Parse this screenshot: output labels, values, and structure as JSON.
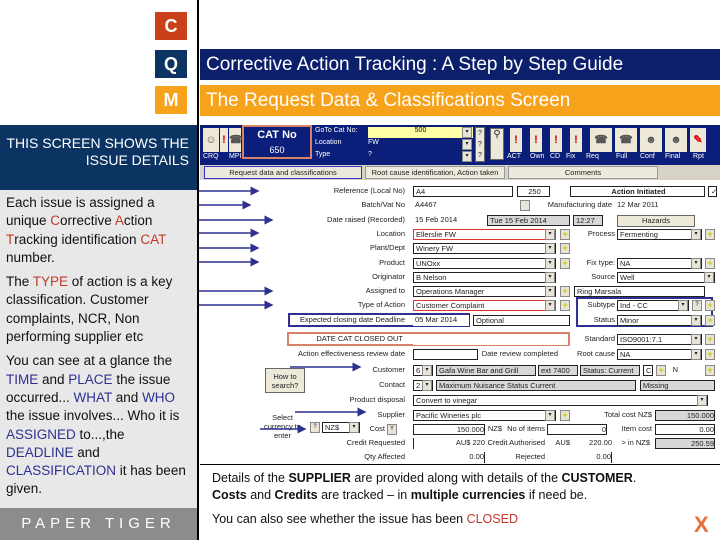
{
  "logo": {
    "c": "C",
    "q": "Q",
    "m": "M"
  },
  "colors": {
    "navy": "#0b1f6b",
    "orange": "#f7a21b",
    "red_logo": "#c8411b",
    "teal_logo": "#0b3463"
  },
  "title": "Corrective Action Tracking : A Step by Step Guide",
  "subtitle": "The Request Data & Classifications Screen",
  "left": {
    "heading": "THIS SCREEN SHOWS THE ISSUE DETAILS",
    "p1": [
      "Each issue is assigned a unique ",
      "C",
      "orrective ",
      "A",
      "ction ",
      "T",
      "racking identification ",
      "CAT",
      " number."
    ],
    "p2": [
      "The ",
      "TYPE",
      " of action is a key classification. Customer complaints, NCR, Non performing supplier etc"
    ],
    "p3": [
      "You can see at a glance the ",
      "TIME",
      " and ",
      "PLACE",
      " the issue occurred... ",
      "WHAT",
      " and ",
      "WHO",
      " the issue involves... Who it is ",
      "ASSIGNED",
      " to...,the ",
      "DEADLINE",
      " and ",
      "CLASSIFICATION",
      " it has been given."
    ],
    "footer": "PAPER TIGER"
  },
  "app": {
    "toolbar": {
      "buttons": [
        "CRQ",
        "MPI",
        "ACT",
        "Own",
        "CD",
        "Fix",
        "Req",
        "Full",
        "Conf",
        "Final",
        "Rpt"
      ],
      "cat_label": "CAT No",
      "cat_value": "650",
      "goto_label": "GoTo Cat No:",
      "goto_value": "500",
      "location_label": "Location",
      "location_value": "FW",
      "type_label": "Type",
      "type_value": "?"
    },
    "tabs": [
      "Request data and classifications",
      "Root cause identification, Action taken",
      "Comments"
    ],
    "rows": {
      "reference": {
        "label": "Reference (Local No)",
        "value": "A4",
        "value2": "250",
        "status": "Action Initiated"
      },
      "batch": {
        "label": "Batch/Vat No",
        "value": "A4467",
        "mfg_label": "Manufacturing date",
        "mfg_value": "12 Mar 2011"
      },
      "date_raised": {
        "label": "Date raised (Recorded)",
        "value": "15 Feb 2014",
        "day": "Tue 15 Feb 2014",
        "time": "12:27",
        "hazards": "Hazards"
      },
      "location": {
        "label": "Location",
        "value": "Ellerslie FW",
        "r_label": "Process",
        "r_value": "Fermenting"
      },
      "plant": {
        "label": "Plant/Dept",
        "value": "Winery FW"
      },
      "product": {
        "label": "Product",
        "value": "UNOxx",
        "r_label": "Fix type:",
        "r_value": "NA"
      },
      "originator": {
        "label": "Originator",
        "value": "B Nelson",
        "r_label": "Source",
        "r_value": "Well"
      },
      "assigned": {
        "label": "Assigned to",
        "value": "Operations Manager",
        "r_value": "Ring Marsala"
      },
      "type": {
        "label": "Type of Action",
        "value": "Customer Complaint",
        "r_label": "Subtype",
        "r_value": "Ind - CC"
      },
      "expected": {
        "label": "Expected closing date Deadline",
        "value": "05 Mar 2014",
        "opt": "Optional",
        "r_label": "Status",
        "r_value": "Minor"
      },
      "closed": {
        "label": "DATE CAT CLOSED OUT",
        "value": "",
        "r_label": "Standard",
        "r_value": "ISO9001:7.1"
      },
      "review": {
        "label": "Action effectiveness review date",
        "mid_label": "Date review completed",
        "r_label": "Root cause",
        "r_value": "NA"
      },
      "customer": {
        "label": "Customer",
        "code": "6",
        "value": "Gafa Wine Bar and Grill",
        "ext": "ext 7400",
        "status": "Status: Current",
        "c": "C",
        "n": "N"
      },
      "contact": {
        "label": "Contact",
        "code": "2",
        "value": "Maximum Nuisance Status Current",
        "r_value": "Missing"
      },
      "disposal": {
        "label": "Product disposal",
        "value": "Convert to vinegar"
      },
      "supplier": {
        "label": "Supplier",
        "value": "Pacific Wineries plc",
        "r_label": "Total cost NZ$",
        "r_value": "150.000"
      },
      "cost": {
        "label": "Cost",
        "code": "Y",
        "value": "150.000",
        "cur": "NZ$",
        "items_label": "No of items",
        "items": "0",
        "item_cost_label": "Item cost",
        "item_cost": "0.00"
      },
      "credit": {
        "label": "Credit Requested",
        "value": "AU$ 220",
        "auth_label": "Credit Authorised",
        "auth_cur": "AU$",
        "auth_value": "220.00",
        "nz_label": "> in NZ$",
        "nz_value": "250.59"
      },
      "qty": {
        "label": "Qty Affected",
        "value": "0.00",
        "rej_label": "Rejected",
        "rej_value": "0.00"
      }
    },
    "how_to_search": "How to search?",
    "select_currency": "Select currency to enter",
    "currency": "NZ$",
    "help": "?"
  },
  "bottom": {
    "d1": "Details of the ",
    "supplier": "SUPPLIER",
    "d2": " are provided along with details of the ",
    "customer": "CUSTOMER",
    "d3": ".",
    "costs": "Costs",
    "d4": " and ",
    "credits": "Credits",
    "d5": " are tracked – in ",
    "multi": "multiple currencies",
    "d6": " if need be.",
    "closed_text": "You can also see whether the issue has been ",
    "closed": "CLOSED",
    "close_x": "X"
  }
}
